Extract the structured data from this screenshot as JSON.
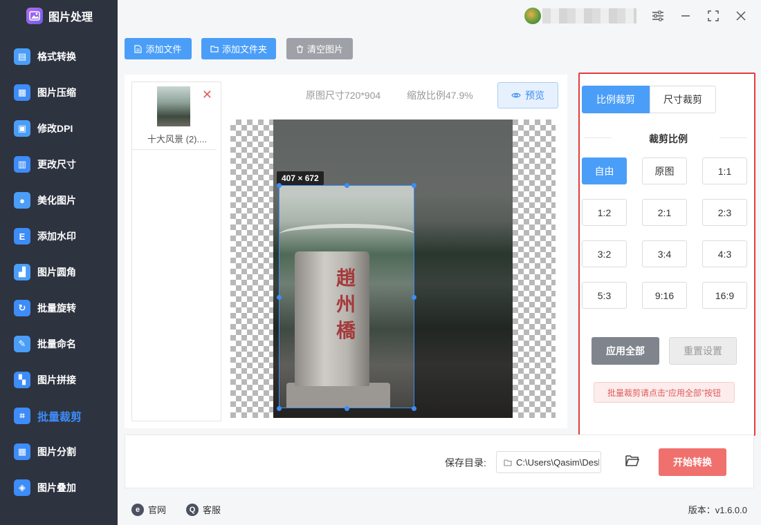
{
  "app": {
    "title": "图片处理"
  },
  "sidebar": {
    "items": [
      {
        "label": "格式转换",
        "icon": "format-convert-icon",
        "color": "#4a9ef8"
      },
      {
        "label": "图片压缩",
        "icon": "compress-icon",
        "color": "#3d8cf7"
      },
      {
        "label": "修改DPI",
        "icon": "dpi-icon",
        "color": "#4a9ef8"
      },
      {
        "label": "更改尺寸",
        "icon": "resize-icon",
        "color": "#3d8cf7"
      },
      {
        "label": "美化图片",
        "icon": "beautify-icon",
        "color": "#4a9ef8"
      },
      {
        "label": "添加水印",
        "icon": "watermark-icon",
        "color": "#3d8cf7"
      },
      {
        "label": "图片圆角",
        "icon": "round-corner-icon",
        "color": "#4a9ef8"
      },
      {
        "label": "批量旋转",
        "icon": "rotate-icon",
        "color": "#3d8cf7"
      },
      {
        "label": "批量命名",
        "icon": "rename-icon",
        "color": "#4a9ef8"
      },
      {
        "label": "图片拼接",
        "icon": "stitch-icon",
        "color": "#3d8cf7"
      },
      {
        "label": "批量裁剪",
        "icon": "crop-icon",
        "color": "#3d8cf7"
      },
      {
        "label": "图片分割",
        "icon": "split-icon",
        "color": "#3d8cf7"
      },
      {
        "label": "图片叠加",
        "icon": "overlay-icon",
        "color": "#3d8cf7"
      }
    ],
    "active_index": 10
  },
  "toolbar": {
    "add_file": "添加文件",
    "add_folder": "添加文件夹",
    "clear_images": "清空图片"
  },
  "file_list": {
    "items": [
      {
        "name": "十大风景 (2)...."
      }
    ]
  },
  "preview": {
    "original_size": "原图尺寸720*904",
    "zoom_ratio": "缩放比例47.9%",
    "preview_label": "预览",
    "crop_dimensions": "407 × 672",
    "stele_text": "趙州橋"
  },
  "crop_panel": {
    "tab_ratio": "比例裁剪",
    "tab_size": "尺寸裁剪",
    "section_title": "裁剪比例",
    "ratios": [
      "自由",
      "原图",
      "1:1",
      "1:2",
      "2:1",
      "2:3",
      "3:2",
      "3:4",
      "4:3",
      "5:3",
      "9:16",
      "16:9"
    ],
    "selected_ratio": "自由",
    "apply_all": "应用全部",
    "reset": "重置设置",
    "hint": "批量裁剪请点击“应用全部”按钮"
  },
  "output": {
    "save_dir_label": "保存目录:",
    "save_dir_value": "C:\\Users\\Qasim\\Deskto",
    "start_button": "开始转换"
  },
  "footer": {
    "website": "官网",
    "support": "客服",
    "version": "版本：v1.6.0.0"
  },
  "colors": {
    "accent": "#4a9ef8",
    "sidebar_bg": "#2e3340",
    "start": "#f0706d",
    "highlight_border": "#e53b3b"
  }
}
